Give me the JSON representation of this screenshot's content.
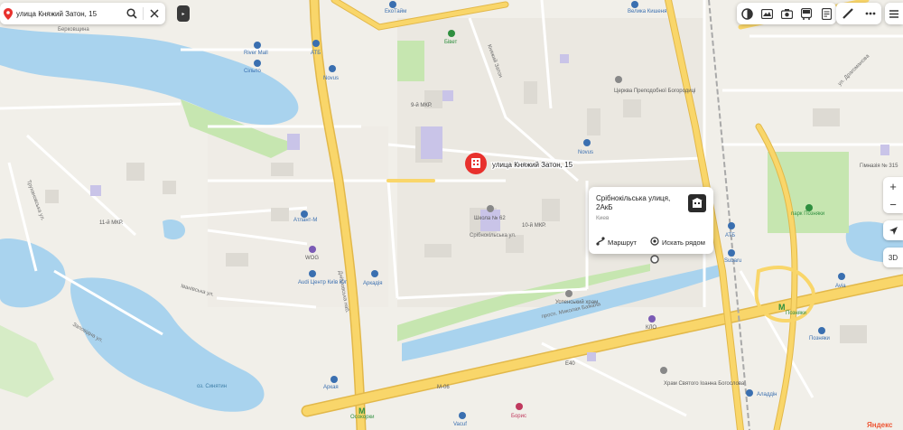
{
  "search": {
    "query": "улица Княжий Затон, 15"
  },
  "marker": {
    "label": "улица Княжий Затон, 15"
  },
  "card": {
    "title": "Срібнокільська улиця, 2АкБ",
    "subtitle": "Киев",
    "route_label": "Маршрут",
    "nearby_label": "Искать рядом"
  },
  "controls": {
    "zoom_in": "+",
    "zoom_out": "−",
    "mode_3d": "3D"
  },
  "brand": {
    "logo": "Яндекс"
  },
  "colors": {
    "marker": "#e8312d",
    "water": "#a9d3ee",
    "park": "#c6e6b0",
    "major_road": "#f9d66a",
    "accent_blue": "#3a6fb0"
  },
  "icons": [
    "search-icon",
    "close-icon",
    "pin-icon",
    "layers-icon",
    "panorama-icon",
    "camera-icon",
    "bus-icon",
    "doc-icon",
    "ruler-icon",
    "more-icon",
    "menu-icon",
    "locate-icon",
    "route-icon",
    "nearby-icon"
  ],
  "map_labels": {
    "street_knyazhyi": "Княжий Затон",
    "bukovel": "Берковщина",
    "river_mall": "River Mall",
    "silpo_top": "Сільпо",
    "atb_top": "АТБ",
    "novus_top": "Novus",
    "ekotain": "ЕкоТайм",
    "velyka_kyshenya": "Велика Кишеня",
    "biwet": "Бівет",
    "district_9": "9-й МКР.",
    "district_11": "11-й МКР.",
    "district_10": "10-й МКР.",
    "church": "Церква Преподобної Богородиці",
    "novus_mid": "Novus",
    "school": "Школа № 62",
    "atlant": "Атлант-М",
    "wog": "WOG",
    "audi": "Audi Центр Київ Юг",
    "arkadia": "Аркадія",
    "srib_street": "Срібнокільська ул.",
    "uspensky": "Успенський храм",
    "prosp_bazhana": "просп. Миколая Бажана",
    "dniprovska": "Дніпровська наб.",
    "lake": "оз. Синятин",
    "arkaya": "Аркая",
    "osokorky": "Осокорки",
    "borys": "Борис",
    "vacuf": "Vacuf",
    "church_bot": "Храм Святого Іоанна Богослова",
    "klo": "КЛО",
    "aladdin": "Аладдін",
    "poznyaky": "Позняки",
    "pozniakyi_mall": "Позняки",
    "ring_park": "парк Позняки",
    "gymnasium": "Гімназія № 315",
    "subaru": "Subaru",
    "avia": "Avia",
    "atb_right": "АТБ",
    "trukhaniv": "Трухановська ул.",
    "street_drahomanova": "ул. Драгоманова",
    "ivanivska": "Іванівська ул.",
    "zapovidna": "Заповідна ул.",
    "m68": "М-06",
    "e40": "Е40"
  }
}
